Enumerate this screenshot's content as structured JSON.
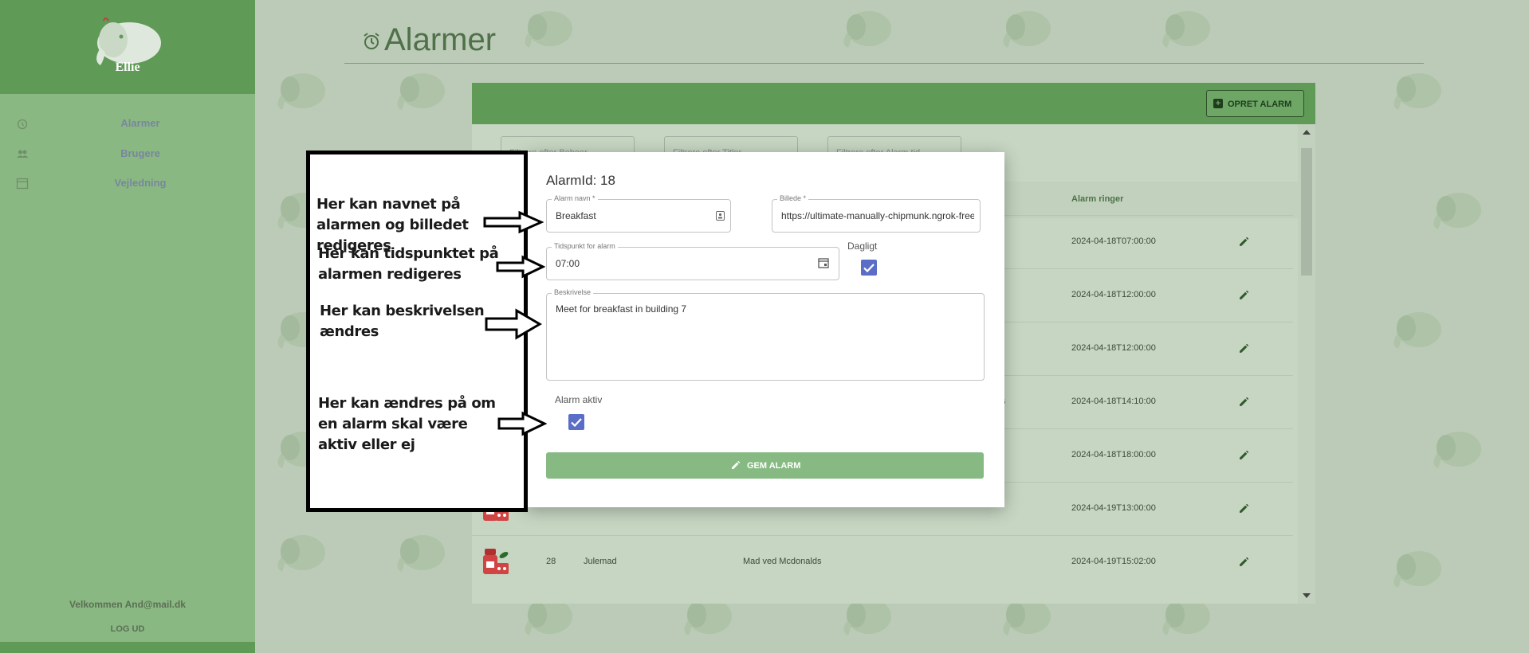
{
  "app": {
    "logo_text": "Ellie"
  },
  "sidebar": {
    "items": [
      {
        "label": "Alarmer",
        "icon": "alarm-clock-icon"
      },
      {
        "label": "Brugere",
        "icon": "users-icon"
      },
      {
        "label": "Vejledning",
        "icon": "calendar-icon"
      }
    ],
    "welcome": "Velkommen And@mail.dk",
    "logout": "LOG UD"
  },
  "page": {
    "title": "Alarmer",
    "title_icon": "alarm-clock-icon"
  },
  "toolbar": {
    "create_label": "OPRET ALARM"
  },
  "filters": [
    {
      "placeholder": "Filtrere efter Beboer"
    },
    {
      "placeholder": "Filtrere efter Titler"
    },
    {
      "placeholder": "Filtrere efter Alarm tid"
    }
  ],
  "table": {
    "headers": {
      "rings": "Alarm ringer"
    },
    "rows": [
      {
        "id": "",
        "title": "",
        "desc": "",
        "time": "2024-04-18T07:00:00"
      },
      {
        "id": "",
        "title": "",
        "desc": "",
        "time": "2024-04-18T12:00:00"
      },
      {
        "id": "",
        "title": "",
        "desc": "",
        "time": "2024-04-18T12:00:00"
      },
      {
        "id": "",
        "title": "",
        "desc": "ases",
        "time": "2024-04-18T14:10:00"
      },
      {
        "id": "",
        "title": "",
        "desc": "",
        "time": "2024-04-18T18:00:00"
      },
      {
        "id": "",
        "title": "",
        "desc": "",
        "time": "2024-04-19T13:00:00"
      },
      {
        "id": "28",
        "title": "Julemad",
        "desc": "Mad ved Mcdonalds",
        "time": "2024-04-19T15:02:00"
      }
    ]
  },
  "modal": {
    "title": "AlarmId: 18",
    "name_label": "Alarm navn *",
    "name_value": "Breakfast",
    "image_label": "Billede *",
    "image_value": "https://ultimate-manually-chipmunk.ngrok-free",
    "time_label": "Tidspunkt for alarm",
    "time_value": "07:00",
    "daily_label": "Dagligt",
    "daily_checked": true,
    "desc_label": "Beskrivelse",
    "desc_value": "Meet for breakfast in building 7",
    "active_label": "Alarm aktiv",
    "active_checked": true,
    "save_label": "GEM ALARM"
  },
  "annotations": {
    "a1": "Her kan navnet på alarmen og billedet redigeres",
    "a2": "Her kan tidspunktet på alarmen redigeres",
    "a3": "Her kan beskrivelsen ændres",
    "a4": "Her kan ændres på om en alarm skal være aktiv eller ej"
  },
  "colors": {
    "sidebar": "#8ab882",
    "header": "#5f9a57",
    "checkbox": "#5a6ec8",
    "save": "#86ba82"
  }
}
